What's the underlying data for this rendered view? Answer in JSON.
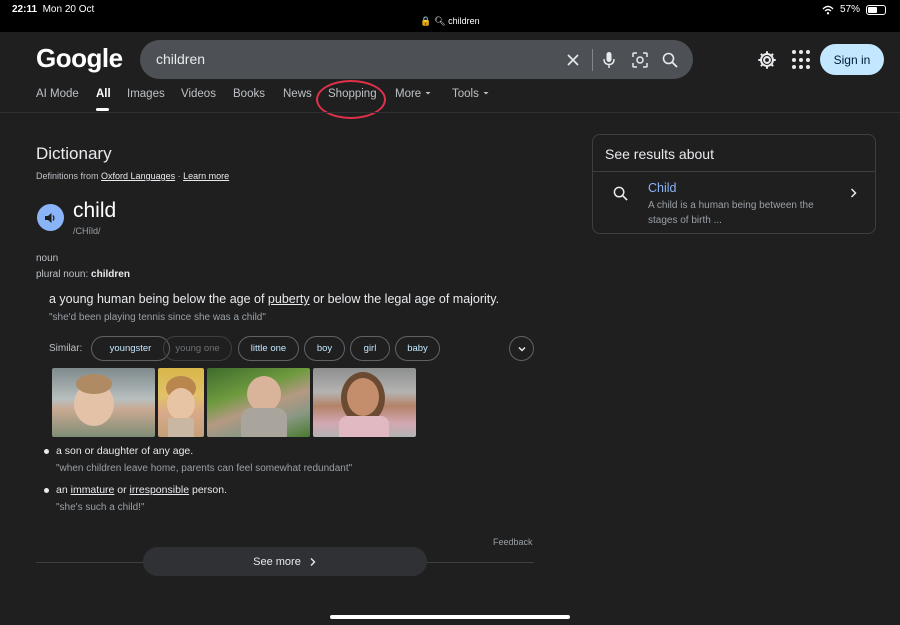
{
  "status_bar": {
    "time": "22:11",
    "date": "Mon 20 Oct",
    "url": "children",
    "battery": "57%",
    "battery_level": 0.57
  },
  "header": {
    "logo": "Google",
    "search_value": "children",
    "sign_in": "Sign in"
  },
  "tabs": [
    "AI Mode",
    "All",
    "Images",
    "Videos",
    "Books",
    "News",
    "Shopping",
    "More",
    "Tools"
  ],
  "active_tab": "All",
  "dictionary": {
    "title": "Dictionary",
    "source_prefix": "Definitions from",
    "source_link": "Oxford Languages",
    "source_sep": " · ",
    "learn_more": "Learn more",
    "word": "child",
    "phonetic": "/CHīld/",
    "part_of_speech": "noun",
    "plural_label": "plural noun:",
    "plural_value": "children",
    "definitions": [
      {
        "parts": [
          "a young human being below the age of ",
          "puberty",
          " or below the legal age of majority."
        ],
        "example": "\"she'd been playing tennis since she was a child\""
      },
      {
        "text": "a son or daughter of any age.",
        "example": "\"when children leave home, parents can feel somewhat redundant\""
      },
      {
        "parts": [
          "an ",
          "immature",
          " or ",
          "irresponsible",
          " person."
        ],
        "example": "\"she's such a child!\""
      }
    ],
    "similar_label": "Similar:",
    "similar": [
      "youngster",
      "young one",
      "little one",
      "boy",
      "girl",
      "baby"
    ],
    "feedback": "Feedback",
    "see_more": "See more"
  },
  "side_card": {
    "title": "See results about",
    "link": "Child",
    "description": "A child is a human being between the stages of birth ..."
  },
  "colors": {
    "background": "#1f1f1f",
    "link": "#8ab4f8",
    "sign_in_bg": "#c2e7ff",
    "highlight_circle": "#e0314b"
  },
  "icons": [
    "wifi-icon",
    "battery-icon",
    "lock-icon",
    "clear-icon",
    "mic-icon",
    "lens-icon",
    "search-icon",
    "gear-icon",
    "apps-icon",
    "speaker-icon",
    "chevron-down-icon",
    "chevron-right-icon"
  ]
}
